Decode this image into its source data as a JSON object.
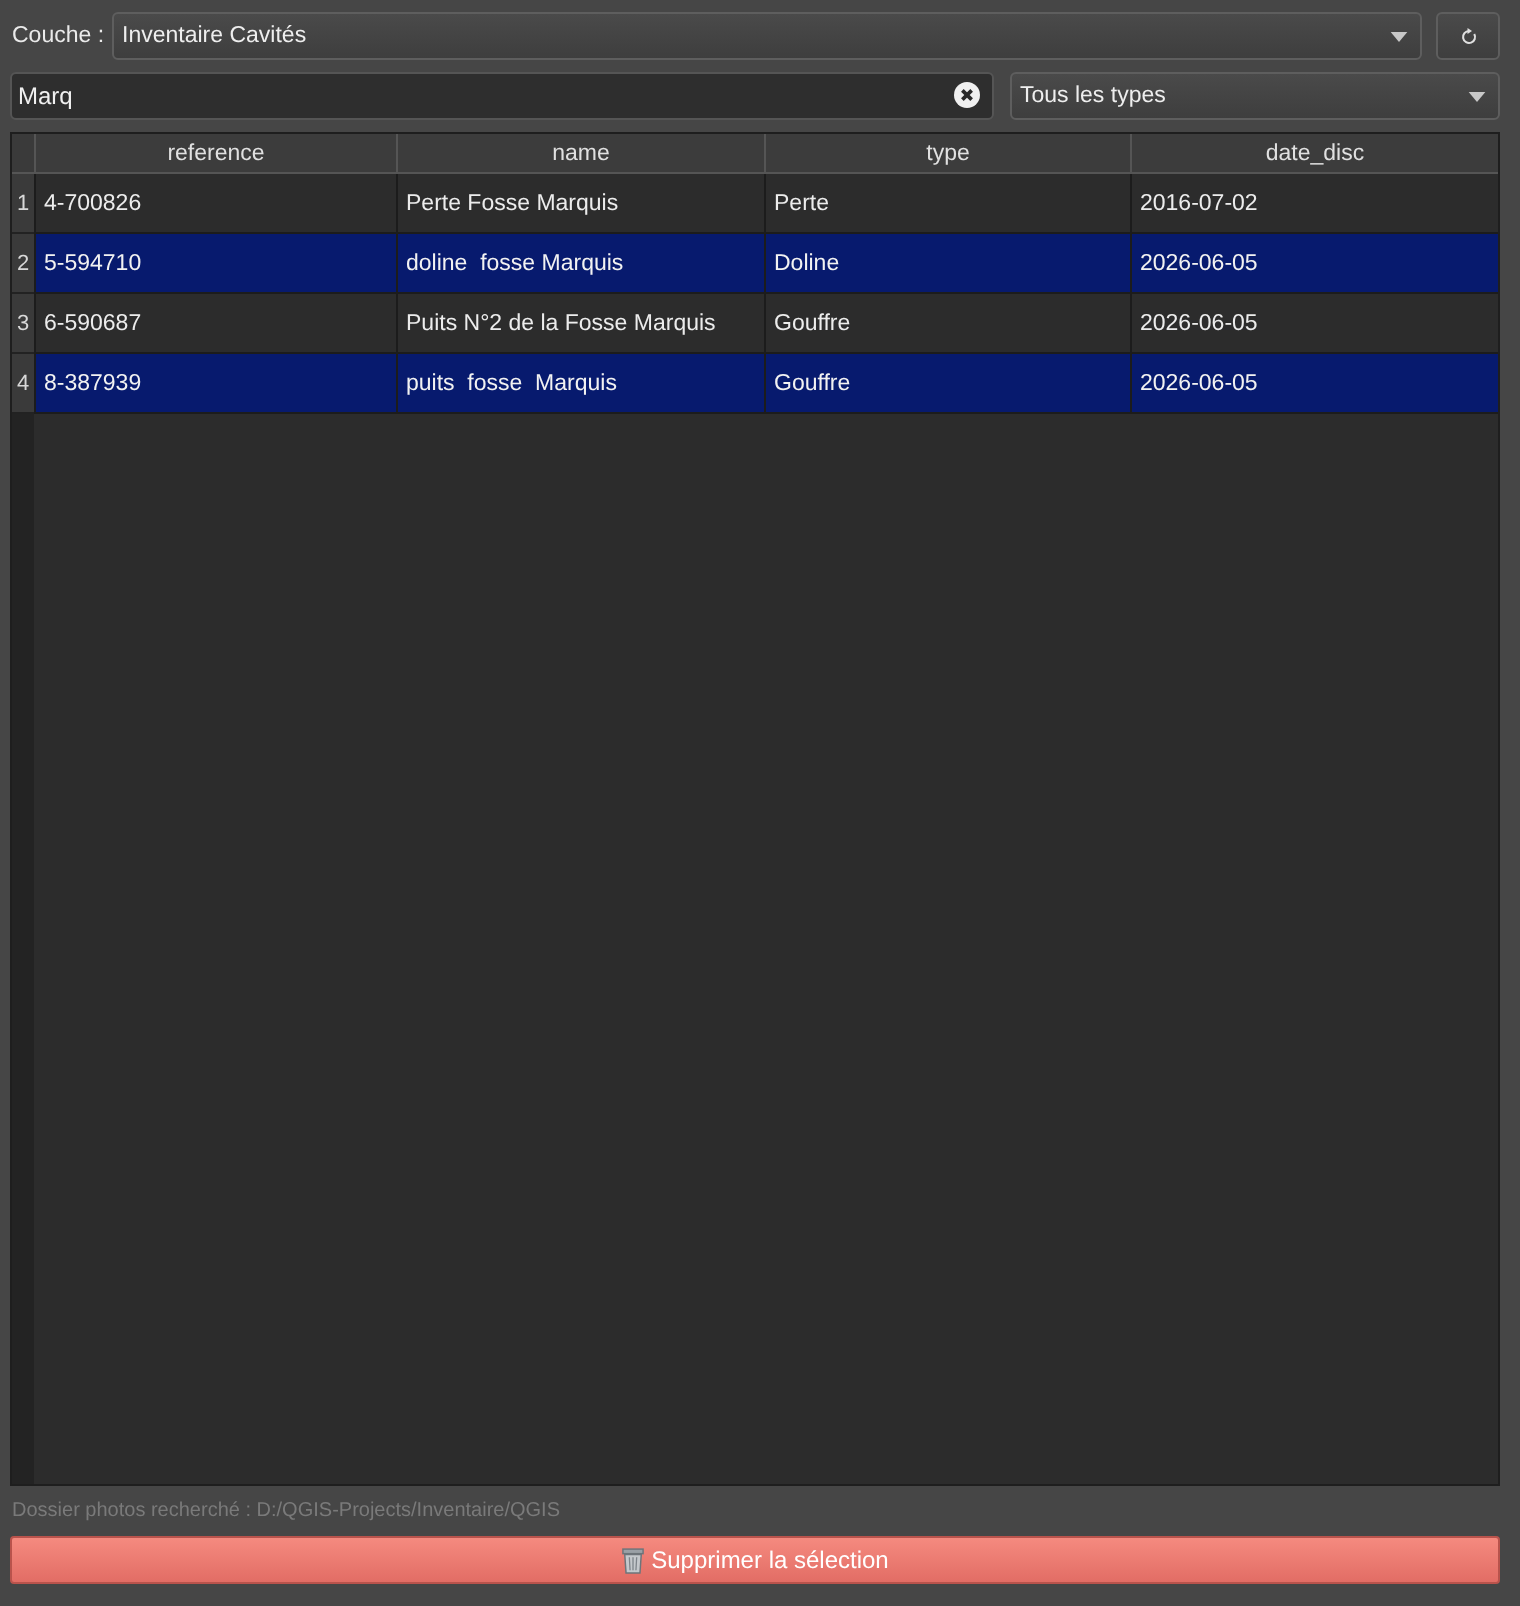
{
  "layer": {
    "label": "Couche :",
    "value": "Inventaire Cavités"
  },
  "search": {
    "value": "Marq"
  },
  "type_filter": {
    "value": "Tous les types"
  },
  "table": {
    "columns": [
      "reference",
      "name",
      "type",
      "date_disc"
    ],
    "rows": [
      {
        "number": "1",
        "selected": false,
        "cells": [
          "4-700826",
          "Perte Fosse Marquis",
          "Perte",
          "2016-07-02"
        ]
      },
      {
        "number": "2",
        "selected": true,
        "cells": [
          "5-594710",
          "doline  fosse Marquis",
          "Doline",
          "2026-06-05"
        ]
      },
      {
        "number": "3",
        "selected": false,
        "cells": [
          "6-590687",
          "Puits N°2 de la Fosse Marquis",
          "Gouffre",
          "2026-06-05"
        ]
      },
      {
        "number": "4",
        "selected": true,
        "cells": [
          "8-387939",
          "puits  fosse  Marquis",
          "Gouffre",
          "2026-06-05"
        ]
      }
    ]
  },
  "photo_folder": "Dossier photos recherché : D:/QGIS-Projects/Inventaire/QGIS",
  "delete_button": {
    "label": "Supprimer la sélection"
  }
}
